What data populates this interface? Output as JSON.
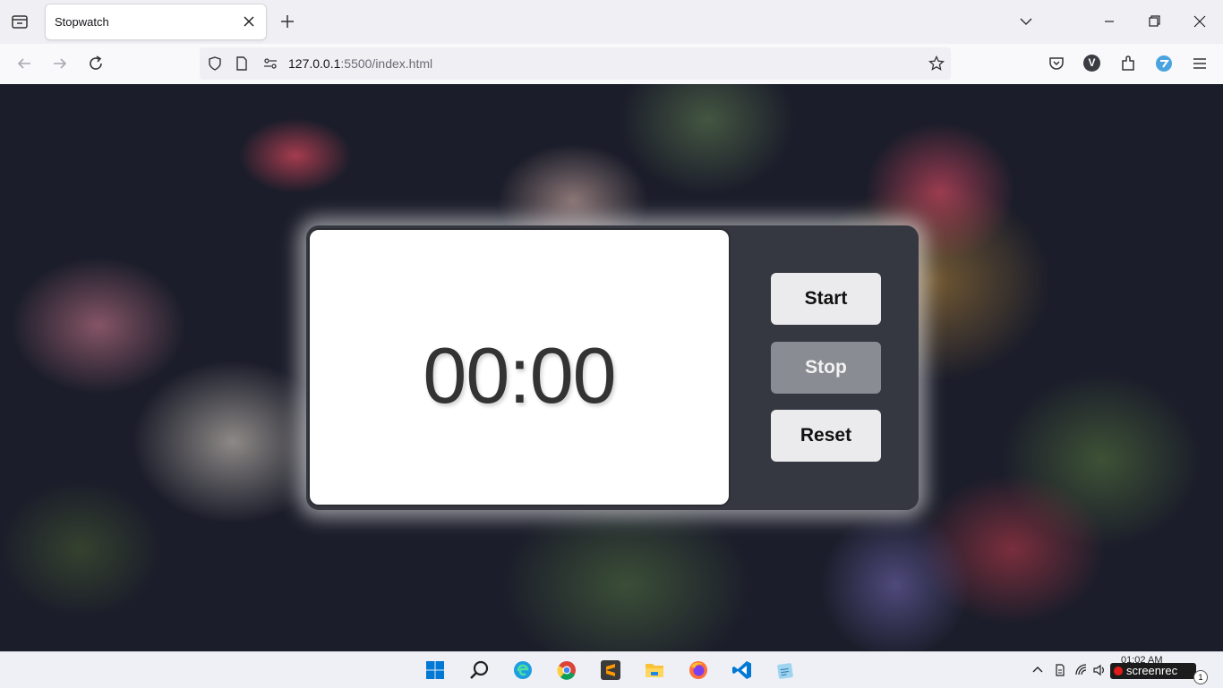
{
  "browser": {
    "tab_title": "Stopwatch",
    "url_host": "127.0.0.1",
    "url_rest": ":5500/index.html",
    "icons": [
      "tabs-list-icon",
      "close-icon",
      "plus-icon",
      "chevron-down-icon",
      "minimize-icon",
      "restore-icon",
      "window-close-icon",
      "back-icon",
      "forward-icon",
      "reload-icon",
      "shield-icon",
      "page-icon",
      "site-info-icon",
      "star-icon",
      "pocket-icon",
      "profile-icon",
      "extensions-icon",
      "extension-icon",
      "menu-icon"
    ],
    "profile_letter": "V"
  },
  "stopwatch": {
    "time": "00:00",
    "start_label": "Start",
    "stop_label": "Stop",
    "reset_label": "Reset"
  },
  "taskbar": {
    "apps": [
      "windows-start-icon",
      "search-icon",
      "edge-icon",
      "chrome-icon",
      "sublime-icon",
      "file-explorer-icon",
      "firefox-icon",
      "vscode-icon",
      "notepad-icon"
    ],
    "clock_time": "01:02 AM",
    "recorder_label": "screenrec",
    "notification_count": "1"
  },
  "colors": {
    "panel": "#353840",
    "stop_button": "#898c92",
    "button": "#ebebed",
    "accent": "#0067c0"
  }
}
